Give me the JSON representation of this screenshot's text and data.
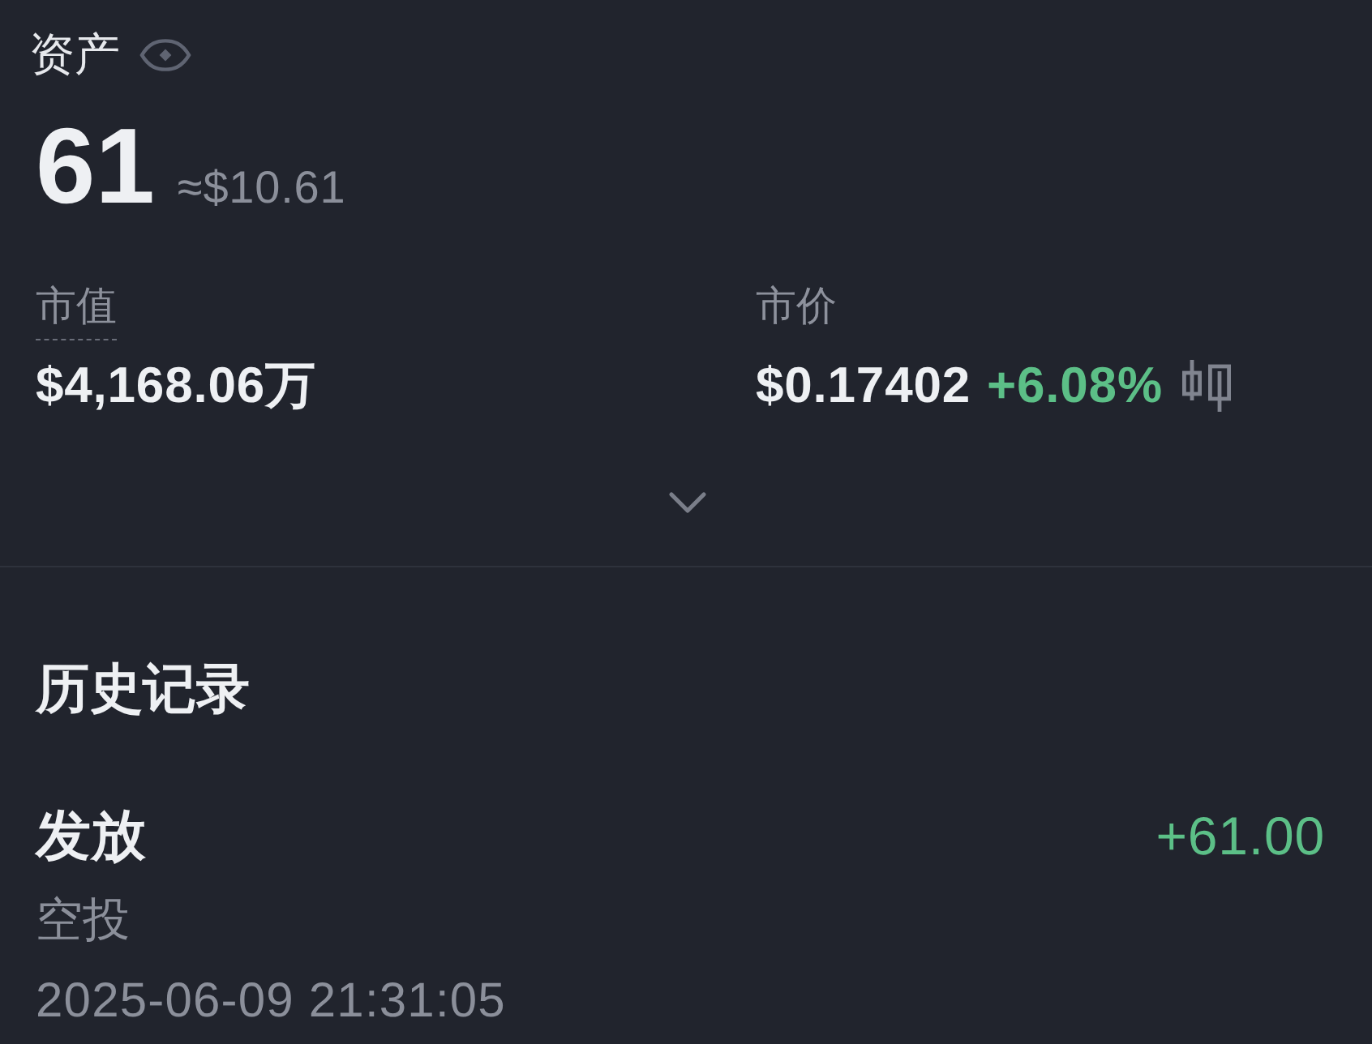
{
  "assets": {
    "label": "资产",
    "amount": "61",
    "approx_value": "≈$10.61"
  },
  "stats": [
    {
      "label": "市值",
      "underlined": true,
      "value": "$4,168.06万"
    },
    {
      "label": "市价",
      "underlined": false,
      "value": "$0.17402",
      "change": "+6.08%"
    }
  ],
  "history": {
    "title": "历史记录",
    "records": [
      {
        "title": "发放",
        "type": "空投",
        "time": "2025-06-09 21:31:05",
        "amount": "+61.00"
      }
    ]
  }
}
